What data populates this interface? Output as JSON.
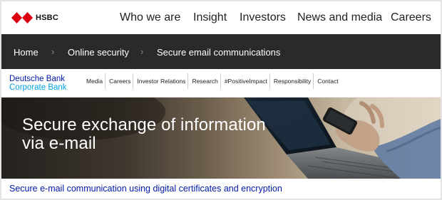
{
  "hsbc": {
    "logo_text": "HSBC",
    "nav": [
      "Who we are",
      "Insight",
      "Investors",
      "News and media",
      "Careers"
    ],
    "brand_color": "#db0011"
  },
  "breadcrumb": {
    "items": [
      "Home",
      "Online security",
      "Secure email communications"
    ],
    "separator": "›"
  },
  "db": {
    "brand_line1": "Deutsche Bank",
    "brand_line2": "Corporate Bank",
    "nav": [
      "Media",
      "Careers",
      "Investor Relations",
      "Research",
      "#PositiveImpact",
      "Responsibility",
      "Contact"
    ]
  },
  "hero": {
    "title_line1": "Secure exchange of information",
    "title_line2": "via e-mail"
  },
  "subtitle": "Secure e-mail communication using digital certificates and encryption"
}
